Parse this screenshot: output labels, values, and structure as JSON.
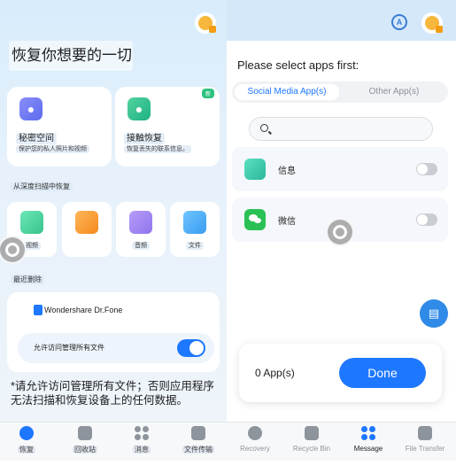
{
  "left": {
    "hero_title": "恢复你想要的一切",
    "cards": [
      {
        "title": "秘密空间",
        "subtitle": "保护您的私人照片和视频",
        "icon": "lock-icon"
      },
      {
        "title": "接触恢复",
        "subtitle": "恢复丢失的联系信息。",
        "icon": "contact-icon",
        "badge": "新"
      }
    ],
    "deep_scan_label": "从深度扫描中恢复",
    "deep_items": [
      {
        "label": "视频",
        "icon": "photo-icon"
      },
      {
        "label": "",
        "icon": "video-icon"
      },
      {
        "label": "音频",
        "icon": "audio-icon"
      },
      {
        "label": "文件",
        "icon": "document-icon"
      }
    ],
    "recent_label": "最近删除",
    "brand_name": "Wondershare Dr.Fone",
    "allow_access_label": "允许访问管理所有文件",
    "notice": "*请允许访问管理所有文件；否则应用程序无法扫描和恢复设备上的任何数据。"
  },
  "right": {
    "title": "Please select apps first:",
    "tabs": [
      "Social Media App(s)",
      "Other App(s)"
    ],
    "search_placeholder": "",
    "apps": [
      {
        "name": "信息",
        "enabled": false
      },
      {
        "name": "微信",
        "enabled": false
      }
    ],
    "count_text": "0 App(s)",
    "done_label": "Done"
  },
  "nav": {
    "left_items": [
      "恢复",
      "回收站",
      "消息",
      "文件传输"
    ],
    "right_items": [
      "Recovery",
      "Recycle Bin",
      "Message",
      "File Transfer"
    ]
  },
  "colors": {
    "accent": "#1d77ff",
    "toggle_on": "#1d77ff",
    "toggle_off": "#c9ccd1"
  }
}
